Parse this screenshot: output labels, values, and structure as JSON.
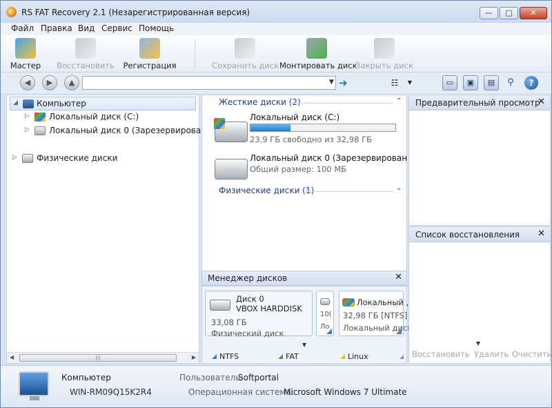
{
  "window": {
    "title": "RS FAT Recovery 2.1 (Незарегистрированная версия)",
    "min_label": "—",
    "max_label": "□",
    "close_label": "✕"
  },
  "menu": [
    "Файл",
    "Правка",
    "Вид",
    "Сервис",
    "Помощь"
  ],
  "toolbar": {
    "master": "Мастер",
    "restore": "Восстановить",
    "register": "Регистрация",
    "save_disk": "Сохранить диск",
    "mount_disk": "Монтировать диск",
    "close_disk": "Закрыть диск"
  },
  "address": {
    "value": "",
    "go_icon": "arrow-right-icon"
  },
  "tree": {
    "computer": "Компьютер",
    "local_c": "Локальный диск (C:)",
    "local_0": "Локальный диск 0 (Зарезервировано си",
    "physical": "Физические диски"
  },
  "center": {
    "hard_disks_header": "Жесткие диски (2)",
    "physical_header": "Физические диски (1)",
    "disks": [
      {
        "name": "Локальный диск (C:)",
        "sub": "23,9 ГБ свободно из 32,98 ГБ",
        "used_fraction": 0.275
      },
      {
        "name": "Локальный диск 0 (Зарезервирован",
        "sub": "Общий размер: 100 МБ"
      }
    ]
  },
  "disk_manager": {
    "title": "Менеджер дисков",
    "card1": {
      "name": "Диск 0",
      "model": "VBOX HARDDISK",
      "size": "33,08 ГБ",
      "type": "Физический диск"
    },
    "card2": {
      "size": "10(",
      "label": "Ло"
    },
    "card3": {
      "name": "Локальный ,",
      "size": "32,98 ГБ [NTFS]",
      "label": "Локальный диск"
    },
    "legend": [
      {
        "label": "NTFS",
        "color": "#3b7fd0"
      },
      {
        "label": "FAT",
        "color": "#3aa53a"
      },
      {
        "label": "Linux",
        "color": "#e6c21a"
      }
    ]
  },
  "preview": {
    "title": "Предварительный просмотр"
  },
  "recovery_list": {
    "title": "Список восстановления",
    "restore": "Восстановить",
    "delete": "Удалить",
    "clear": "Очистить"
  },
  "status": {
    "name": "Компьютер",
    "host": "WIN-RM09Q15K2R4",
    "user_label": "Пользователь:",
    "user": "Softportal",
    "os_label": "Операционная система:",
    "os": "Microsoft Windows 7 Ultimate"
  }
}
